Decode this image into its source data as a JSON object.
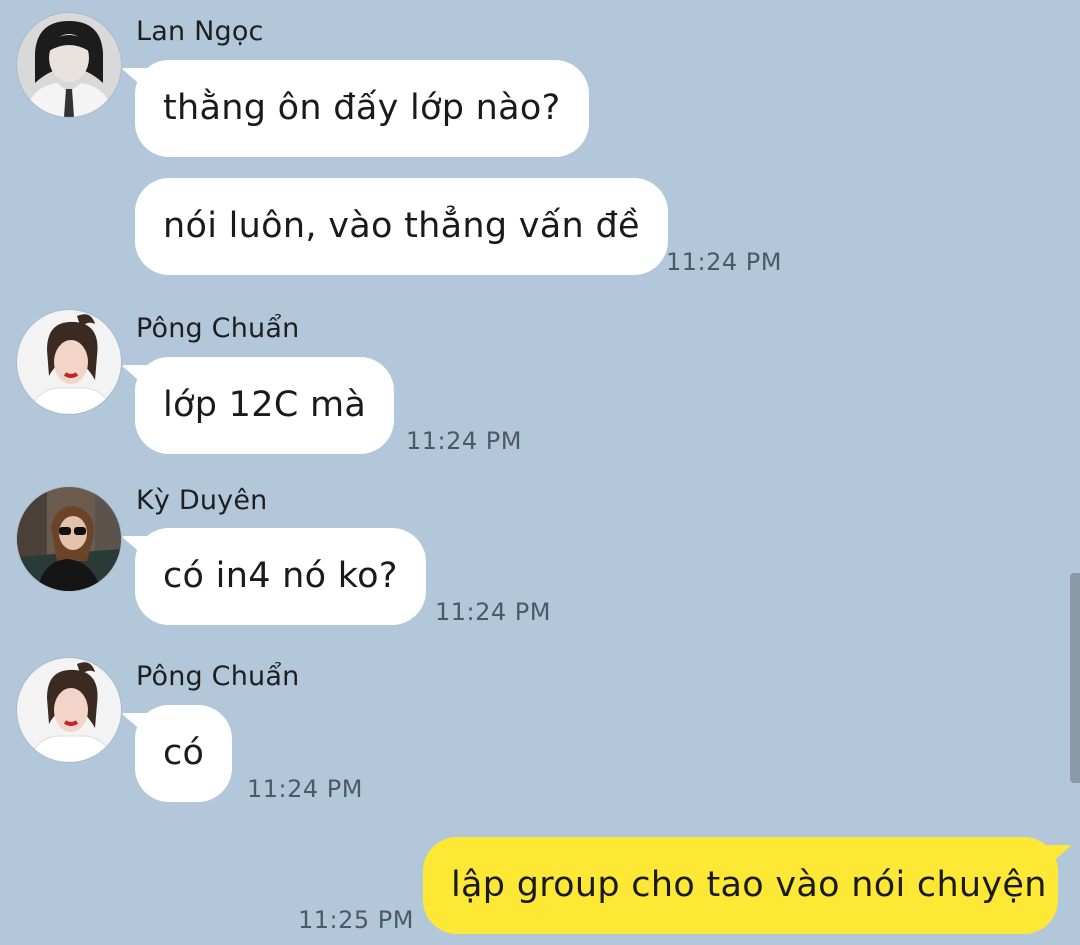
{
  "messages": [
    {
      "sender": "Lan Ngọc",
      "avatar_icon": "avatar-lan-ngoc",
      "bubbles": [
        "thằng ôn đấy lớp nào?",
        "nói luôn, vào thẳng vấn đề"
      ],
      "time": "11:24 PM"
    },
    {
      "sender": "Pông Chuẩn",
      "avatar_icon": "avatar-pong-chuan",
      "bubbles": [
        "lớp 12C mà"
      ],
      "time": "11:24 PM"
    },
    {
      "sender": "Kỳ Duyên",
      "avatar_icon": "avatar-ky-duyen",
      "bubbles": [
        "có in4 nó ko?"
      ],
      "time": "11:24 PM"
    },
    {
      "sender": "Pông Chuẩn",
      "avatar_icon": "avatar-pong-chuan",
      "bubbles": [
        "có"
      ],
      "time": "11:24 PM"
    }
  ],
  "my_message": {
    "text": "lập group cho tao vào nói chuyện",
    "time": "11:25 PM"
  },
  "colors": {
    "background": "#b2c7da",
    "incoming_bubble": "#ffffff",
    "outgoing_bubble": "#fee836",
    "timestamp": "#4d5a66"
  }
}
